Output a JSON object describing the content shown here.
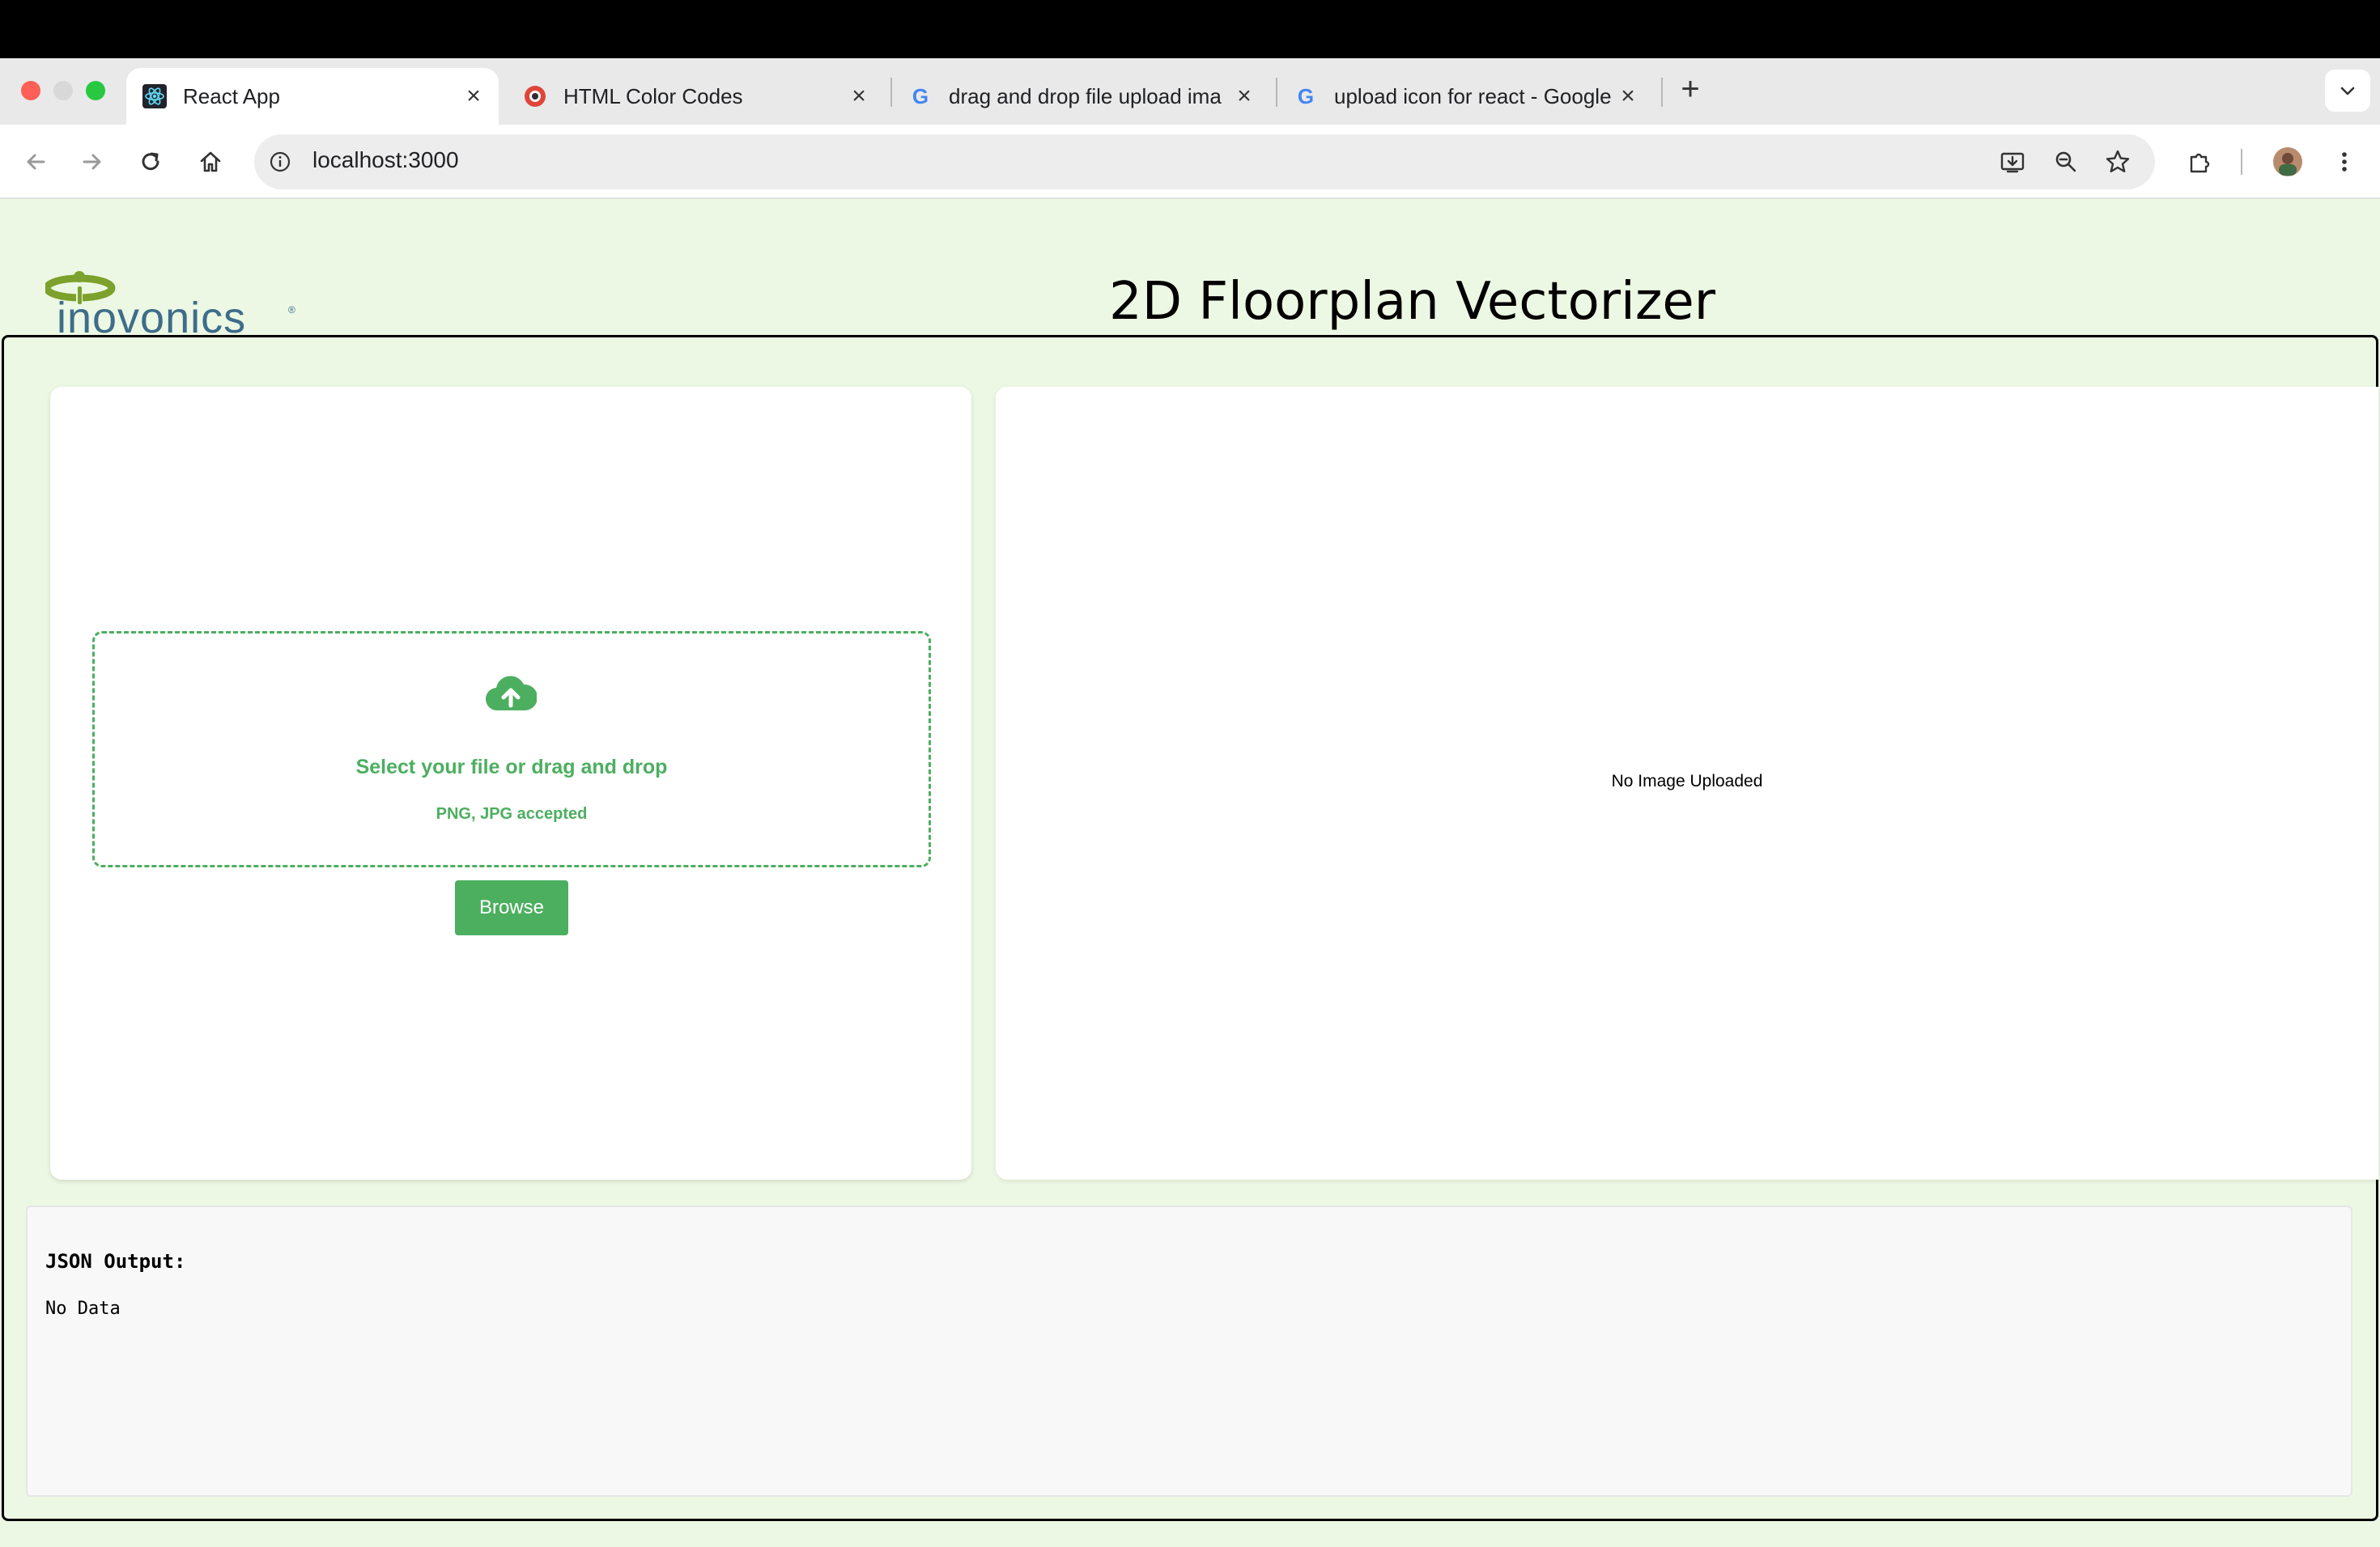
{
  "browser": {
    "tabs": [
      {
        "label": "React App",
        "icon": "react-icon",
        "active": true
      },
      {
        "label": "HTML Color Codes",
        "icon": "html-color-codes-icon",
        "active": false
      },
      {
        "label": "drag and drop file upload ima",
        "icon": "google-icon",
        "active": false
      },
      {
        "label": "upload icon for react - Google",
        "icon": "google-icon",
        "active": false
      }
    ],
    "new_tab": "+",
    "url": "localhost:3000"
  },
  "header": {
    "logo_text": "inovonics",
    "title": "2D Floorplan Vectorizer"
  },
  "upload": {
    "title": "Select your file or drag and drop",
    "subtitle": "PNG, JPG accepted",
    "browse_label": "Browse"
  },
  "preview": {
    "empty_text": "No Image Uploaded"
  },
  "json_output": {
    "title": "JSON Output:",
    "value": "No Data"
  },
  "colors": {
    "page_bg": "#ecf8e3",
    "accent_green": "#4caf60",
    "logo_blue": "#3e6c8a",
    "logo_green": "#7ca12c"
  }
}
